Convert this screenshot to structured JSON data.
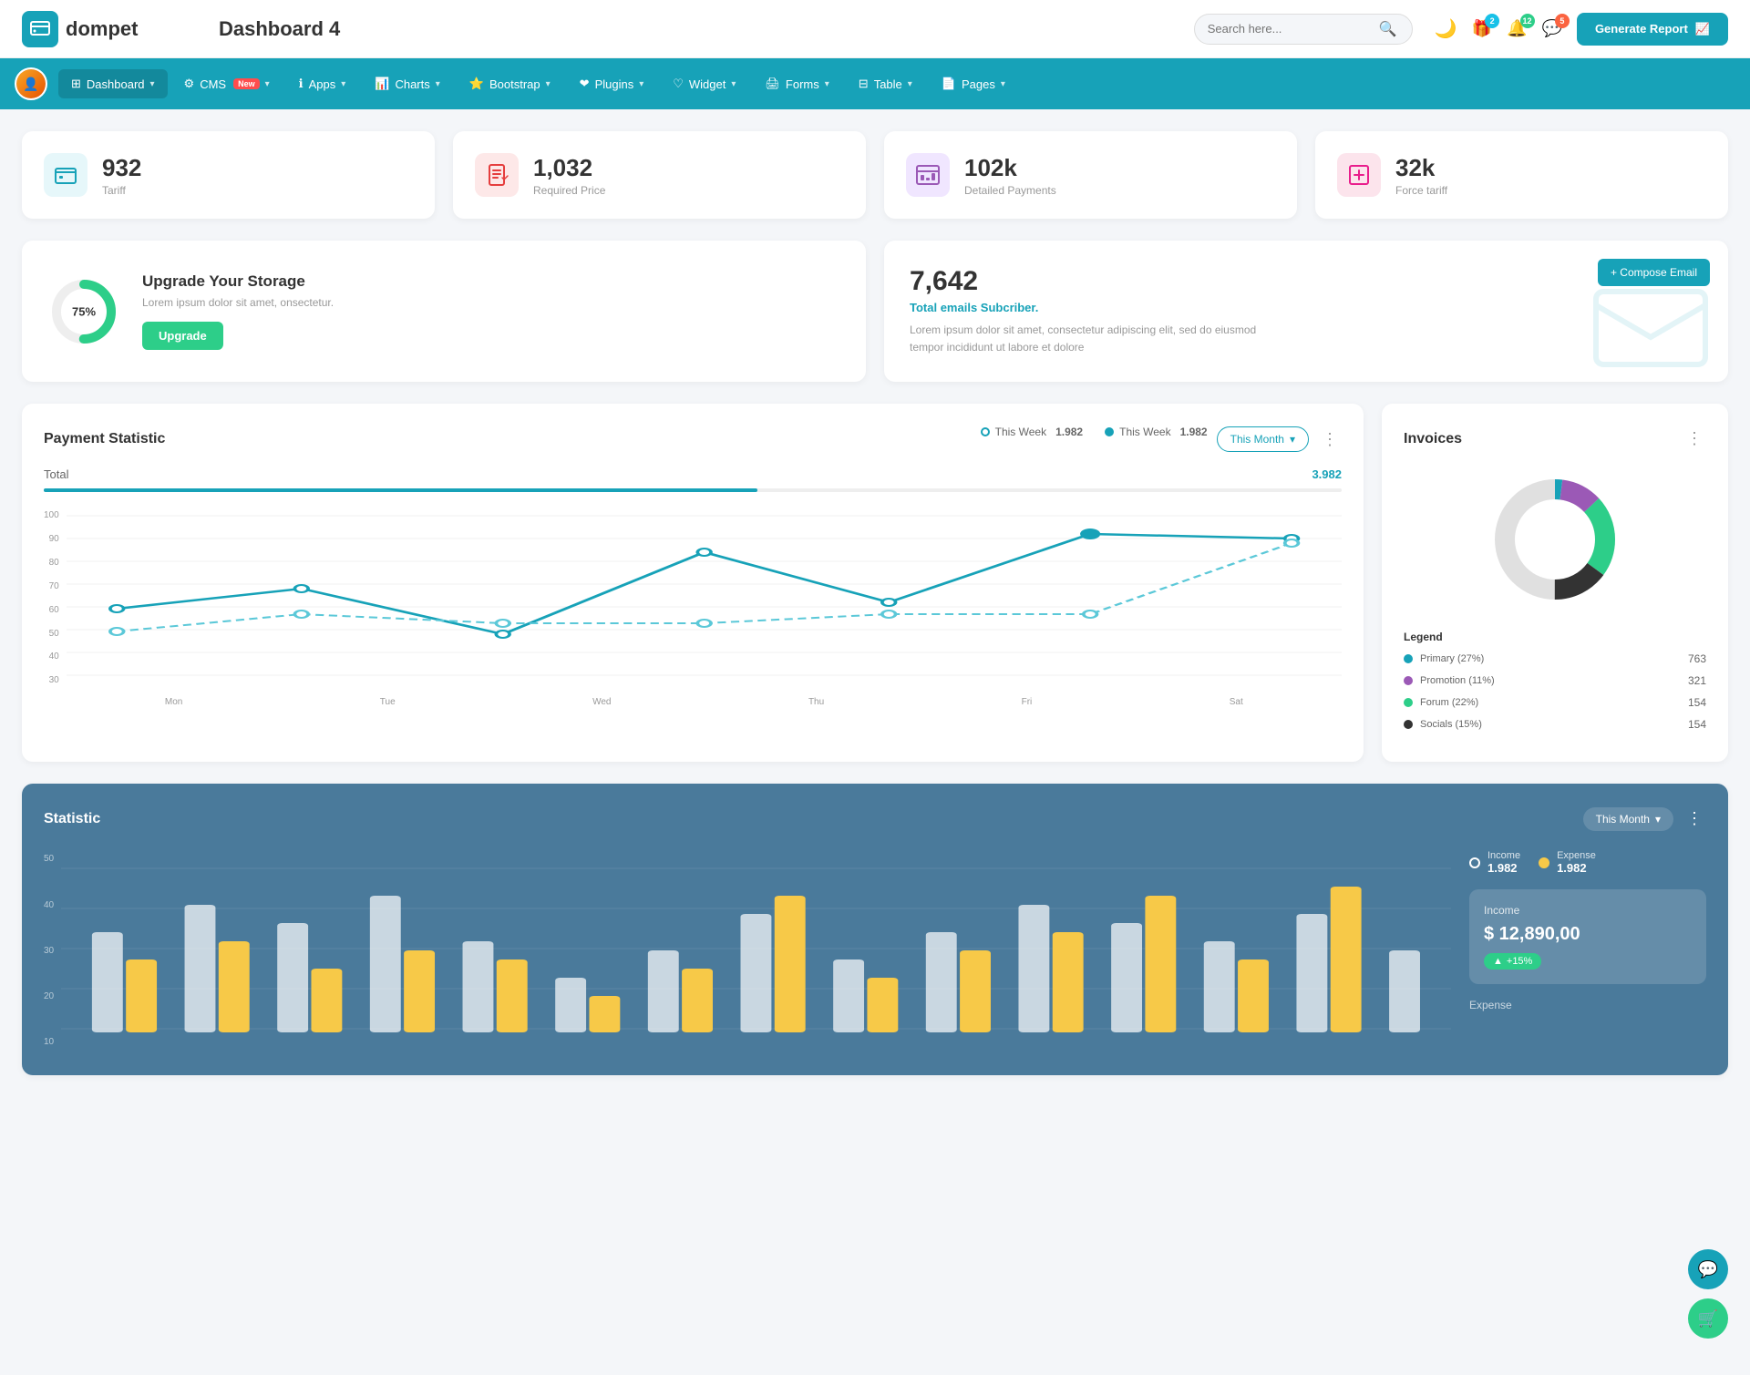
{
  "header": {
    "logo_text": "dompet",
    "title": "Dashboard 4",
    "search_placeholder": "Search here...",
    "generate_btn": "Generate Report",
    "badges": {
      "gift": "2",
      "bell": "12",
      "chat": "5"
    }
  },
  "nav": {
    "items": [
      {
        "id": "dashboard",
        "label": "Dashboard",
        "arrow": true,
        "active": true
      },
      {
        "id": "cms",
        "label": "CMS",
        "arrow": true,
        "badge": "New"
      },
      {
        "id": "apps",
        "label": "Apps",
        "arrow": true
      },
      {
        "id": "charts",
        "label": "Charts",
        "arrow": true
      },
      {
        "id": "bootstrap",
        "label": "Bootstrap",
        "arrow": true
      },
      {
        "id": "plugins",
        "label": "Plugins",
        "arrow": true
      },
      {
        "id": "widget",
        "label": "Widget",
        "arrow": true
      },
      {
        "id": "forms",
        "label": "Forms",
        "arrow": true
      },
      {
        "id": "table",
        "label": "Table",
        "arrow": true
      },
      {
        "id": "pages",
        "label": "Pages",
        "arrow": true
      }
    ]
  },
  "stat_cards": [
    {
      "id": "tariff",
      "value": "932",
      "label": "Tariff",
      "icon": "💼",
      "color": "teal"
    },
    {
      "id": "required-price",
      "value": "1,032",
      "label": "Required Price",
      "icon": "📋",
      "color": "red"
    },
    {
      "id": "detailed-payments",
      "value": "102k",
      "label": "Detailed Payments",
      "icon": "📊",
      "color": "purple"
    },
    {
      "id": "force-tariff",
      "value": "32k",
      "label": "Force tariff",
      "icon": "🏪",
      "color": "pink"
    }
  ],
  "storage": {
    "percent": "75%",
    "title": "Upgrade Your Storage",
    "description": "Lorem ipsum dolor sit amet, onsectetur.",
    "btn_label": "Upgrade",
    "donut_percent": 75
  },
  "email": {
    "count": "7,642",
    "subtitle": "Total emails Subcriber.",
    "description": "Lorem ipsum dolor sit amet, consectetur adipiscing elit, sed do eiusmod tempor incididunt ut labore et dolore",
    "compose_btn": "+ Compose Email"
  },
  "payment_statistic": {
    "title": "Payment Statistic",
    "filter_label": "This Month",
    "legend": [
      {
        "id": "this-week-1",
        "label": "This Week",
        "value": "1.982",
        "filled": false
      },
      {
        "id": "this-week-2",
        "label": "This Week",
        "value": "1.982",
        "filled": true
      }
    ],
    "total_label": "Total",
    "total_value": "3.982",
    "progress_percent": 55,
    "x_labels": [
      "Mon",
      "Tue",
      "Wed",
      "Thu",
      "Fri",
      "Sat"
    ],
    "y_labels": [
      "100",
      "90",
      "80",
      "70",
      "60",
      "50",
      "40",
      "30"
    ],
    "line1_points": "30,112 140,90 260,140 380,50 490,105 610,30 730,35",
    "line2_points": "30,137 140,118 260,128 380,128 490,118 610,118 730,40"
  },
  "invoices": {
    "title": "Invoices",
    "legend_title": "Legend",
    "items": [
      {
        "id": "primary",
        "label": "Primary (27%)",
        "color": "#17a2b8",
        "value": "763"
      },
      {
        "id": "promotion",
        "label": "Promotion (11%)",
        "color": "#9b59b6",
        "value": "321"
      },
      {
        "id": "forum",
        "label": "Forum (22%)",
        "color": "#2dce89",
        "value": "154"
      },
      {
        "id": "socials",
        "label": "Socials (15%)",
        "color": "#333",
        "value": "154"
      }
    ],
    "donut": {
      "segments": [
        {
          "color": "#17a2b8",
          "pct": 27
        },
        {
          "color": "#9b59b6",
          "pct": 11
        },
        {
          "color": "#2dce89",
          "pct": 22
        },
        {
          "color": "#333",
          "pct": 15
        },
        {
          "color": "#e0e0e0",
          "pct": 25
        }
      ]
    }
  },
  "statistic": {
    "title": "Statistic",
    "filter_label": "This Month",
    "y_labels": [
      "50",
      "40",
      "30",
      "20",
      "10"
    ],
    "x_labels": [
      "",
      "",
      "",
      "",
      "",
      "",
      "",
      "",
      "",
      "",
      "",
      "",
      "",
      "",
      "",
      ""
    ],
    "income": {
      "label": "Income",
      "value": "1.982",
      "card_title": "Income",
      "amount": "$ 12,890,00",
      "badge": "+15%"
    },
    "expense": {
      "label": "Expense",
      "value": "1.982",
      "section_label": "Expense"
    }
  },
  "floating": {
    "chat_icon": "💬",
    "cart_icon": "🛒"
  }
}
